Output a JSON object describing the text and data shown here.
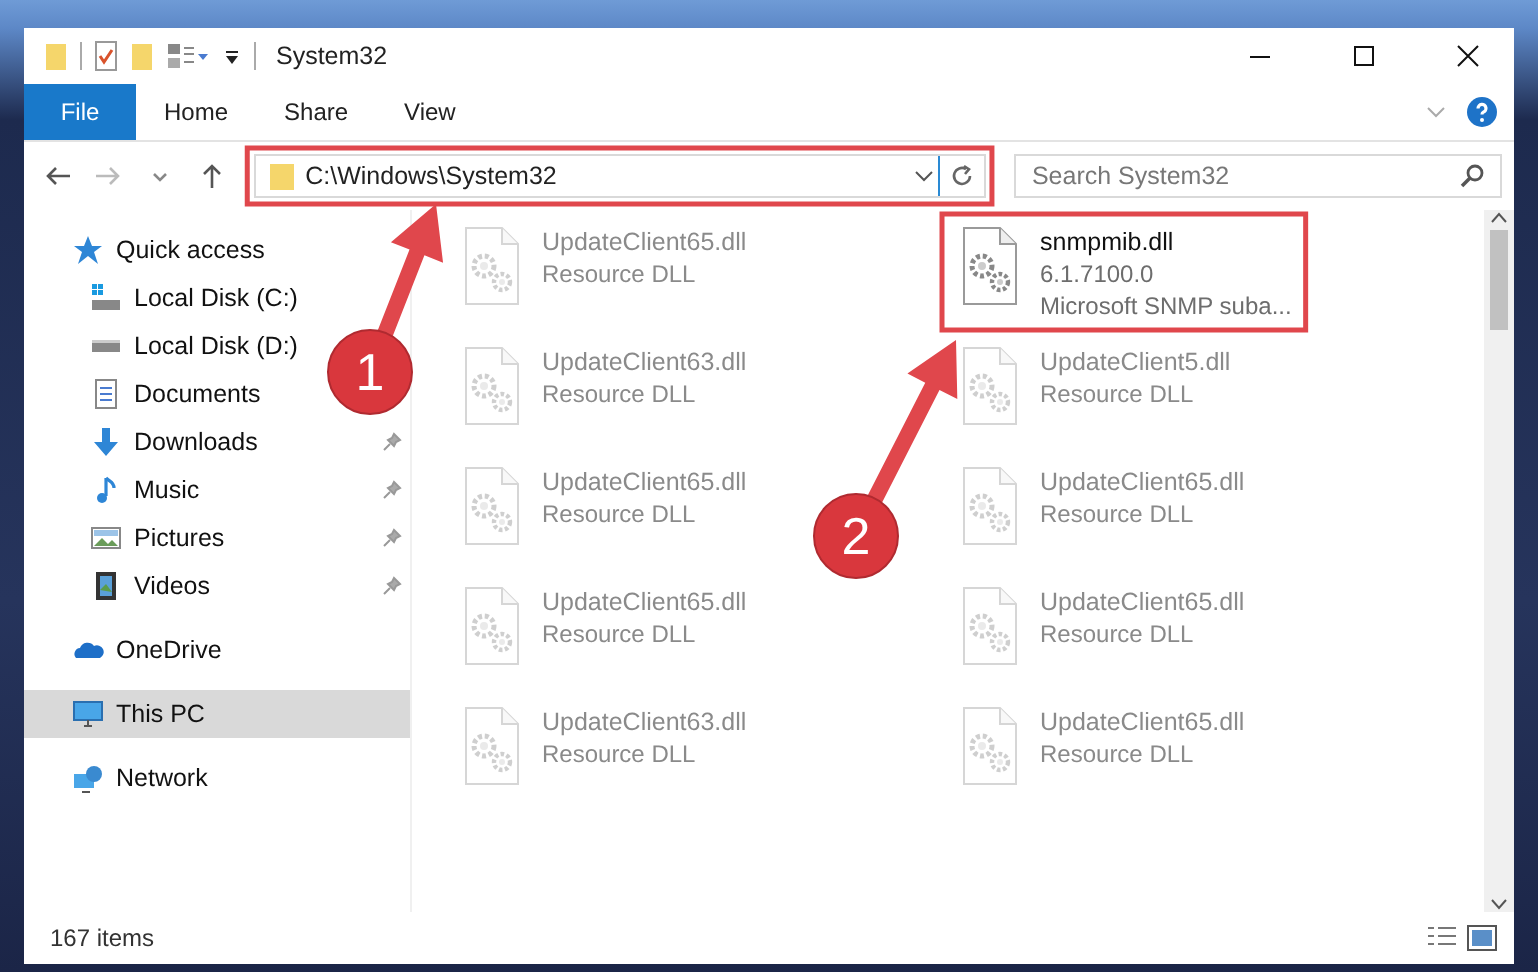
{
  "window": {
    "title": "System32"
  },
  "ribbon": {
    "tabs": [
      {
        "label": "File",
        "selected": true
      },
      {
        "label": "Home",
        "selected": false
      },
      {
        "label": "Share",
        "selected": false
      },
      {
        "label": "View",
        "selected": false
      }
    ]
  },
  "address_bar": {
    "path": "C:\\Windows\\System32"
  },
  "search": {
    "placeholder": "Search System32"
  },
  "navigation": [
    {
      "label": "Quick access",
      "kind": "quick",
      "selected": false,
      "children": [
        {
          "label": "Local Disk (C:)",
          "kind": "drive-c",
          "selected": false,
          "pinned": false
        },
        {
          "label": "Local Disk (D:)",
          "kind": "drive",
          "selected": false,
          "pinned": false
        },
        {
          "label": "Documents",
          "kind": "documents",
          "selected": false,
          "pinned": false
        },
        {
          "label": "Downloads",
          "kind": "downloads",
          "selected": false,
          "pinned": true
        },
        {
          "label": "Music",
          "kind": "music",
          "selected": false,
          "pinned": true
        },
        {
          "label": "Pictures",
          "kind": "pictures",
          "selected": false,
          "pinned": true
        },
        {
          "label": "Videos",
          "kind": "videos",
          "selected": false,
          "pinned": true
        }
      ]
    },
    {
      "label": "OneDrive",
      "kind": "cloud",
      "selected": false
    },
    {
      "label": "This PC",
      "kind": "pc",
      "selected": true
    },
    {
      "label": "Network",
      "kind": "network",
      "selected": false
    }
  ],
  "files": [
    {
      "name": "UpdateClient65.dll",
      "description": "Resource DLL",
      "kind": "faded"
    },
    {
      "name": "snmpmib.dll",
      "version": "6.1.7100.0",
      "description": "Microsoft SNMP suba...",
      "kind": "focused"
    },
    {
      "name": "UpdateClient63.dll",
      "description": "Resource DLL",
      "kind": "faded"
    },
    {
      "name": "UpdateClient5.dll",
      "description": "Resource DLL",
      "kind": "faded"
    },
    {
      "name": "UpdateClient65.dll",
      "description": "Resource DLL",
      "kind": "faded"
    },
    {
      "name": "UpdateClient65.dll",
      "description": "Resource DLL",
      "kind": "faded"
    },
    {
      "name": "UpdateClient65.dll",
      "description": "Resource DLL",
      "kind": "faded"
    },
    {
      "name": "UpdateClient65.dll",
      "description": "Resource DLL",
      "kind": "faded"
    },
    {
      "name": "UpdateClient63.dll",
      "description": "Resource DLL",
      "kind": "faded"
    },
    {
      "name": "UpdateClient65.dll",
      "description": "Resource DLL",
      "kind": "faded"
    }
  ],
  "status_bar": {
    "item_count": "167 items"
  },
  "annotations": [
    {
      "label": "1"
    },
    {
      "label": "2"
    }
  ]
}
